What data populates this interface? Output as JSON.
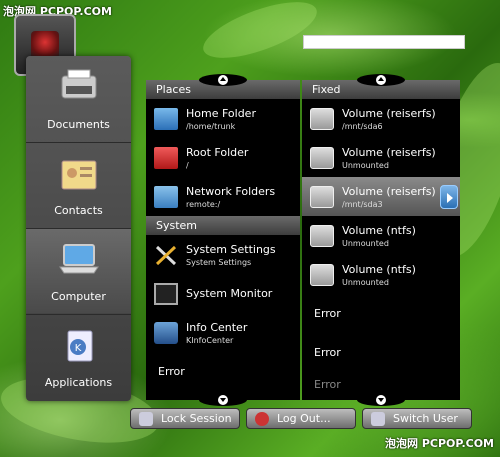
{
  "watermark": {
    "top": "泡泡网 PCPOP.COM",
    "bottom": "泡泡网 PCPOP.COM"
  },
  "sidebar": {
    "items": [
      {
        "label": "Documents",
        "icon": "typewriter-icon"
      },
      {
        "label": "Contacts",
        "icon": "contacts-icon"
      },
      {
        "label": "Computer",
        "icon": "laptop-icon"
      },
      {
        "label": "Applications",
        "icon": "applications-icon"
      }
    ]
  },
  "places": {
    "header": "Places",
    "items": [
      {
        "title": "Home Folder",
        "subtitle": "/home/trunk",
        "icon": "home-folder-icon"
      },
      {
        "title": "Root Folder",
        "subtitle": "/",
        "icon": "root-folder-icon"
      },
      {
        "title": "Network Folders",
        "subtitle": "remote:/",
        "icon": "network-folder-icon"
      }
    ],
    "system_header": "System",
    "system_items": [
      {
        "title": "System Settings",
        "subtitle": "System Settings",
        "icon": "settings-tools-icon"
      },
      {
        "title": "System Monitor",
        "subtitle": "",
        "icon": "monitor-icon"
      },
      {
        "title": "Info Center",
        "subtitle": "KInfoCenter",
        "icon": "info-center-icon"
      }
    ],
    "error": "Error"
  },
  "fixed": {
    "header": "Fixed",
    "items": [
      {
        "title": "Volume (reiserfs)",
        "subtitle": "/mnt/sda6"
      },
      {
        "title": "Volume (reiserfs)",
        "subtitle": "Unmounted"
      },
      {
        "title": "Volume (reiserfs)",
        "subtitle": "/mnt/sda3"
      },
      {
        "title": "Volume (ntfs)",
        "subtitle": "Unmounted"
      },
      {
        "title": "Volume (ntfs)",
        "subtitle": "Unmounted"
      }
    ],
    "errors": [
      "Error",
      "Error",
      "Error"
    ]
  },
  "actions": {
    "lock": "Lock Session",
    "logout": "Log Out...",
    "switch": "Switch User"
  }
}
